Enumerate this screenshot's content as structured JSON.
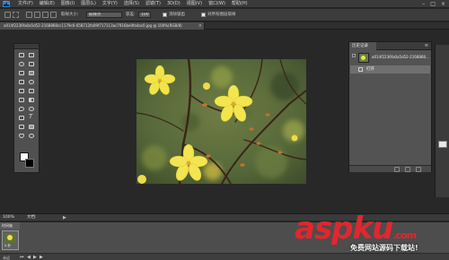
{
  "app": {
    "logo_text": "Ps",
    "menu_items": [
      "文件(F)",
      "编辑(E)",
      "图像(I)",
      "图层(L)",
      "文字(Y)",
      "选择(S)",
      "滤镜(T)",
      "3D(D)",
      "视图(V)",
      "窗口(W)",
      "帮助(H)"
    ],
    "window_controls": [
      "–",
      "□",
      "×"
    ]
  },
  "options_bar": {
    "feather_label": "羽化:",
    "feather_value": "0 像素",
    "antialias_label": "消除锯齿",
    "style_label": "样式:",
    "style_value": "正常",
    "width_label": "宽度:",
    "height_label": "高度:",
    "refine_edge_label": "调整边缘...",
    "sample_size_label": "取样大小:",
    "sample_size_value": "取样点",
    "tolerance_label": "容差:",
    "tolerance_value": "100",
    "contiguous_label": "消除锯齿",
    "all_layers_label": "对所有图层取样"
  },
  "document": {
    "tab_title": "a014f2236fa0a5d52-2168868cc1179c6-658712fa09f717113ac7916be0fa4ac0.jpg @ 100%(RGB/8)",
    "zoom": "100%",
    "doc_info": "文档:"
  },
  "history_panel": {
    "tab_label": "历史记录",
    "snapshot_name": "a014f2236fa0a5d52-2168868...",
    "open_step": "打开"
  },
  "timeline": {
    "tab_label": "时间轴",
    "frame_time": "0 秒",
    "loop_label": "永远"
  },
  "watermark": {
    "logo": "aspku",
    "logo_suffix": ".com",
    "tagline": "免费网站源码下载站!"
  },
  "colors": {
    "foreground": "#ffffff",
    "background": "#000000",
    "accent": "#e3262d"
  }
}
